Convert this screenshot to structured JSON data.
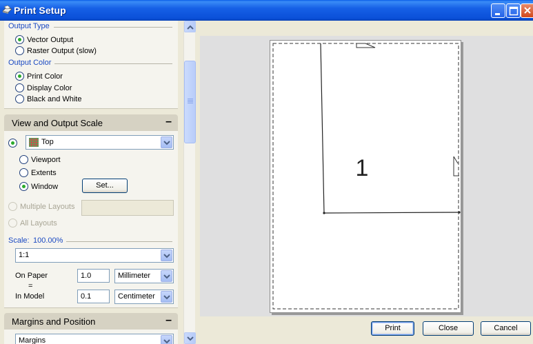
{
  "window": {
    "title": "Print Setup"
  },
  "output_type": {
    "title": "Output Type",
    "options": [
      {
        "label": "Vector Output",
        "checked": true
      },
      {
        "label": "Raster Output (slow)",
        "checked": false
      }
    ]
  },
  "output_color": {
    "title": "Output Color",
    "options": [
      {
        "label": "Print Color",
        "checked": true
      },
      {
        "label": "Display Color",
        "checked": false
      },
      {
        "label": "Black and White",
        "checked": false
      }
    ]
  },
  "view_scale": {
    "header": "View and Output Scale",
    "collapse_glyph": "–",
    "viewport_select": "Top",
    "area_options": [
      {
        "label": "Viewport",
        "checked": false
      },
      {
        "label": "Extents",
        "checked": false
      },
      {
        "label": "Window",
        "checked": true
      }
    ],
    "set_button": "Set...",
    "multiple_layouts": "Multiple Layouts",
    "all_layouts": "All Layouts",
    "scale_label": "Scale:",
    "scale_value": "100.00%",
    "scale_select": "1:1",
    "on_paper_label": "On Paper",
    "equals": "=",
    "in_model_label": "In Model",
    "on_paper_value": "1.0",
    "on_paper_unit": "Millimeter",
    "in_model_value": "0.1",
    "in_model_unit": "Centimeter"
  },
  "margins": {
    "header": "Margins and Position",
    "collapse_glyph": "–",
    "select": "Margins"
  },
  "preview": {
    "page_number": "1"
  },
  "buttons": {
    "print": "Print",
    "close": "Close",
    "cancel": "Cancel"
  },
  "colors": {
    "titlebar": "#0a4fd8",
    "group_title": "#1a49c2",
    "radio_check": "#2bab2b"
  }
}
